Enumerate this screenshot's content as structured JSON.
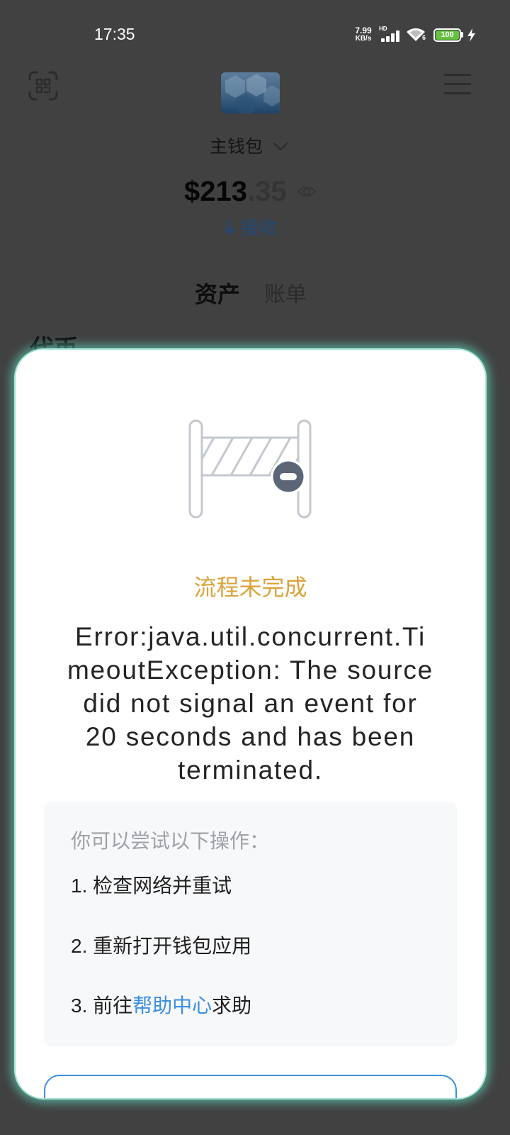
{
  "status_bar": {
    "time": "17:35",
    "net_speed_value": "7.99",
    "net_speed_unit": "KB/s",
    "network_type": "HD",
    "wifi_standard": "6",
    "battery_level": "100",
    "icons": [
      "signal-icon",
      "wifi-icon",
      "battery-icon",
      "charging-icon"
    ]
  },
  "header": {
    "left_icon": "qr-scan-icon",
    "center_icon": "wallet-avatar",
    "right_icon": "menu-icon"
  },
  "wallet": {
    "name": "主钱包",
    "balance_whole": "$213",
    "balance_fraction": ".35",
    "receive_label": "接收",
    "icons": [
      "chevron-down-icon",
      "eye-icon",
      "arrow-down-icon"
    ]
  },
  "tabs": [
    {
      "label": "资产",
      "active": true
    },
    {
      "label": "账单",
      "active": false
    }
  ],
  "section": {
    "title": "代币"
  },
  "dialog": {
    "icon": "barrier-gate-icon",
    "title": "流程未完成",
    "message": "Error:java.util.concurrent.TimeoutException: The source did not signal an event for 20 seconds and has been terminated.",
    "suggestions": {
      "heading": "你可以尝试以下操作：",
      "items": [
        {
          "text": "1. 检查网络并重试"
        },
        {
          "text": "2. 重新打开钱包应用"
        },
        {
          "prefix": "3. 前往",
          "link": "帮助中心",
          "suffix": "求助"
        }
      ]
    }
  },
  "colors": {
    "overlay_background": "#414141",
    "dialog_title": "#dba33d",
    "link_accent": "#3a8fe0",
    "dialog_glow": "#5fcdb4",
    "battery_fill": "#66c23f"
  }
}
